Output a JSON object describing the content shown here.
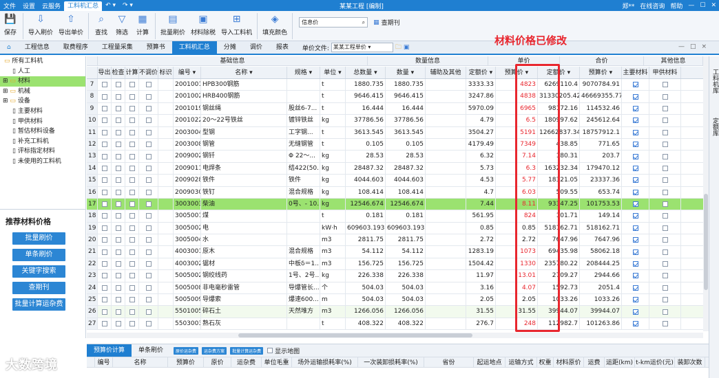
{
  "titlebar": {
    "menus": [
      "文件",
      "设置",
      "云服务",
      "工料机汇总"
    ],
    "active_menu": 3,
    "title": "某某工程 [编制]",
    "right_items": [
      "郑**",
      "在线咨询",
      "帮助"
    ]
  },
  "ribbon": {
    "buttons": [
      "保存",
      "导入刷价",
      "导出单价",
      "查找",
      "筛选",
      "计算",
      "批量刷价",
      "材料除税",
      "导入工料机",
      "填充颜色"
    ],
    "search_placeholder": "信息价",
    "check_label": "查期刊"
  },
  "tabs": {
    "items": [
      "工程信息",
      "取费程序",
      "工程量采集",
      "预算书",
      "工料机汇总",
      "分摊",
      "调价",
      "报表"
    ],
    "active": 4,
    "unit_file_label": "单价文件:",
    "unit_file_value": "某某工程单价"
  },
  "annotation": "材料价格已修改",
  "tree": [
    "所有工料机",
    "人工",
    "材料",
    "机械",
    "设备",
    "主要材料",
    "甲供材料",
    "暂估材料设备",
    "补充工料机",
    "评标指定材料",
    "未使用的工料机"
  ],
  "tree_selected": 2,
  "left_panel": {
    "title": "推荐材料价格",
    "buttons": [
      "批量刷价",
      "单条刷价",
      "关键字搜索",
      "查期刊",
      "批量计算运杂费"
    ]
  },
  "grid": {
    "groups": [
      "基础信息",
      "数量信息",
      "单价",
      "合价",
      "其他信息"
    ],
    "columns": [
      "",
      "导出",
      "检查",
      "计算",
      "不调价",
      "标识",
      "编号",
      "名称",
      "规格",
      "单位",
      "总数量",
      "数量",
      "辅助及其他",
      "定额价",
      "预算价",
      "定额价",
      "预算价",
      "主要材料",
      "甲供材料"
    ],
    "rows": [
      {
        "n": "7",
        "code": "2001001",
        "name": "HPB300钢筋",
        "spec": "",
        "unit": "t",
        "total": "1880.735",
        "qty": "1880.735",
        "dprice": "3333.33",
        "yprice": "4823",
        "dsum": "6269110.4",
        "ysum": "9070784.91",
        "red": true
      },
      {
        "n": "8",
        "code": "2001002",
        "name": "HRB400钢筋",
        "spec": "",
        "unit": "t",
        "total": "9646.415",
        "qty": "9646.415",
        "dprice": "3247.86",
        "yprice": "4838",
        "dsum": "31330205.42",
        "ysum": "46669355.77",
        "red": true
      },
      {
        "n": "9",
        "code": "2001019",
        "name": "钢丝绳",
        "spec": "股丝6-7...",
        "unit": "t",
        "total": "16.444",
        "qty": "16.444",
        "dprice": "5970.09",
        "yprice": "6965",
        "dsum": "98172.16",
        "ysum": "114532.46",
        "red": true
      },
      {
        "n": "10",
        "code": "2001022",
        "name": "20～22号铁丝",
        "spec": "镀锌铁丝",
        "unit": "kg",
        "total": "37786.56",
        "qty": "37786.56",
        "dprice": "4.79",
        "yprice": "6.5",
        "dsum": "180997.62",
        "ysum": "245612.64",
        "red": true
      },
      {
        "n": "11",
        "code": "2003004",
        "name": "型钢",
        "spec": "工字钢...",
        "unit": "t",
        "total": "3613.545",
        "qty": "3613.545",
        "dprice": "3504.27",
        "yprice": "5191",
        "dsum": "12662837.34",
        "ysum": "18757912.1",
        "red": true
      },
      {
        "n": "12",
        "code": "2003008",
        "name": "钢管",
        "spec": "无缝钢管",
        "unit": "t",
        "total": "0.105",
        "qty": "0.105",
        "dprice": "4179.49",
        "yprice": "7349",
        "dsum": "438.85",
        "ysum": "771.65",
        "red": true
      },
      {
        "n": "13",
        "code": "2009002",
        "name": "钢钎",
        "spec": "Φ 22～...",
        "unit": "kg",
        "total": "28.53",
        "qty": "28.53",
        "dprice": "6.32",
        "yprice": "7.14",
        "dsum": "180.31",
        "ysum": "203.7",
        "red": true
      },
      {
        "n": "14",
        "code": "2009011",
        "name": "电焊条",
        "spec": "结422(50...",
        "unit": "kg",
        "total": "28487.32",
        "qty": "28487.32",
        "dprice": "5.73",
        "yprice": "6.3",
        "dsum": "163232.34",
        "ysum": "179470.12",
        "red": true
      },
      {
        "n": "15",
        "code": "2009028",
        "name": "铁件",
        "spec": "铁件",
        "unit": "kg",
        "total": "4044.603",
        "qty": "4044.603",
        "dprice": "4.53",
        "yprice": "5.77",
        "dsum": "18321.05",
        "ysum": "23337.36",
        "red": true
      },
      {
        "n": "16",
        "code": "2009030",
        "name": "铁钉",
        "spec": "混合规格",
        "unit": "kg",
        "total": "108.414",
        "qty": "108.414",
        "dprice": "4.7",
        "yprice": "6.03",
        "dsum": "509.55",
        "ysum": "653.74",
        "red": true
      },
      {
        "n": "17",
        "code": "3003003",
        "name": "柴油",
        "spec": "0号、- 10...",
        "unit": "kg",
        "total": "12546.674",
        "qty": "12546.674",
        "dprice": "7.44",
        "yprice": "8.11",
        "dsum": "93347.25",
        "ysum": "101753.53",
        "red": true,
        "hl": true
      },
      {
        "n": "18",
        "code": "3005001",
        "name": "煤",
        "spec": "",
        "unit": "t",
        "total": "0.181",
        "qty": "0.181",
        "dprice": "561.95",
        "yprice": "824",
        "dsum": "101.71",
        "ysum": "149.14",
        "red": true
      },
      {
        "n": "19",
        "code": "3005002",
        "name": "电",
        "spec": "",
        "unit": "kW·h",
        "total": "609603.193",
        "qty": "609603.193",
        "dprice": "0.85",
        "yprice": "0.85",
        "dsum": "518162.71",
        "ysum": "518162.71",
        "red": false
      },
      {
        "n": "20",
        "code": "3005004",
        "name": "水",
        "spec": "",
        "unit": "m3",
        "total": "2811.75",
        "qty": "2811.75",
        "dprice": "2.72",
        "yprice": "2.72",
        "dsum": "7647.96",
        "ysum": "7647.96",
        "red": false
      },
      {
        "n": "21",
        "code": "4003001",
        "name": "原木",
        "spec": "混合规格",
        "unit": "m3",
        "total": "54.112",
        "qty": "54.112",
        "dprice": "1283.19",
        "yprice": "1073",
        "dsum": "69435.98",
        "ysum": "58062.18",
        "red": true
      },
      {
        "n": "22",
        "code": "4003002",
        "name": "锯材",
        "spec": "中板δ＝1...",
        "unit": "m3",
        "total": "156.725",
        "qty": "156.725",
        "dprice": "1504.42",
        "yprice": "1330",
        "dsum": "235780.22",
        "ysum": "208444.25",
        "red": true
      },
      {
        "n": "23",
        "code": "5005002",
        "name": "钢绞线药",
        "spec": "1号、2号...",
        "unit": "kg",
        "total": "226.338",
        "qty": "226.338",
        "dprice": "11.97",
        "yprice": "13.01",
        "dsum": "2709.27",
        "ysum": "2944.66",
        "red": true
      },
      {
        "n": "24",
        "code": "5005008",
        "name": "非电毫秒雷管",
        "spec": "导爆管长...",
        "unit": "个",
        "total": "504.03",
        "qty": "504.03",
        "dprice": "3.16",
        "yprice": "4.07",
        "dsum": "1592.73",
        "ysum": "2051.4",
        "red": true
      },
      {
        "n": "25",
        "code": "5005009",
        "name": "导爆索",
        "spec": "爆速600...",
        "unit": "m",
        "total": "504.03",
        "qty": "504.03",
        "dprice": "2.05",
        "yprice": "2.05",
        "dsum": "1033.26",
        "ysum": "1033.26",
        "red": false
      },
      {
        "n": "26",
        "code": "5501005",
        "name": "碎石土",
        "spec": "天然堆方",
        "unit": "m3",
        "total": "1266.056",
        "qty": "1266.056",
        "dprice": "31.55",
        "yprice": "31.55",
        "dsum": "39944.07",
        "ysum": "39944.07",
        "red": false,
        "alt": true
      },
      {
        "n": "27",
        "code": "5503003",
        "name": "熟石灰",
        "spec": "",
        "unit": "t",
        "total": "408.322",
        "qty": "408.322",
        "dprice": "276.7",
        "yprice": "248",
        "dsum": "112982.7",
        "ysum": "101263.86",
        "red": true
      }
    ]
  },
  "bottom": {
    "tabs": [
      "预算价计算",
      "单条刷价"
    ],
    "small_buttons": [
      "原价运杂费",
      "运杂费方案",
      "批量计算运杂费"
    ],
    "map_check": "显示地图",
    "columns": [
      "编号",
      "名称",
      "预算价",
      "原价",
      "运杂费",
      "单位毛重",
      "场外运输损耗率(%)",
      "一次装卸损耗率(%)",
      "省份",
      "起运地点",
      "运输方式",
      "权重",
      "材料原价",
      "运费",
      "运距(km)",
      "t-km运价(元)",
      "装卸次数"
    ]
  },
  "right_side_tabs": [
    "工料机库",
    "定额库"
  ],
  "watermark": "大数跨境"
}
